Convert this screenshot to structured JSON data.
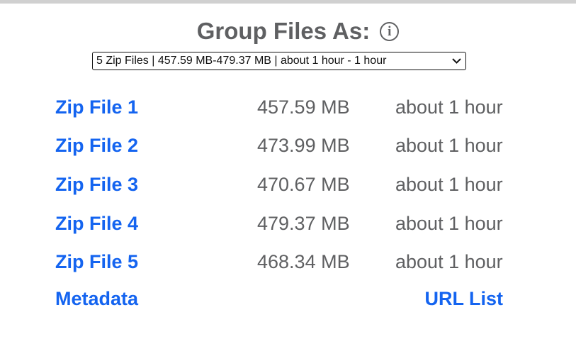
{
  "header": {
    "title": "Group Files As:",
    "info_icon": "info-circle-icon"
  },
  "group_select": {
    "selected": "5 Zip Files | 457.59 MB-479.37 MB | about 1 hour - 1 hour"
  },
  "files": [
    {
      "name": "Zip File 1",
      "size": "457.59 MB",
      "time": "about 1 hour"
    },
    {
      "name": "Zip File 2",
      "size": "473.99 MB",
      "time": "about 1 hour"
    },
    {
      "name": "Zip File 3",
      "size": "470.67 MB",
      "time": "about 1 hour"
    },
    {
      "name": "Zip File 4",
      "size": "479.37 MB",
      "time": "about 1 hour"
    },
    {
      "name": "Zip File 5",
      "size": "468.34 MB",
      "time": "about 1 hour"
    }
  ],
  "footer": {
    "metadata_label": "Metadata",
    "url_list_label": "URL List"
  },
  "colors": {
    "link": "#1464f0",
    "text": "#5f6062"
  }
}
